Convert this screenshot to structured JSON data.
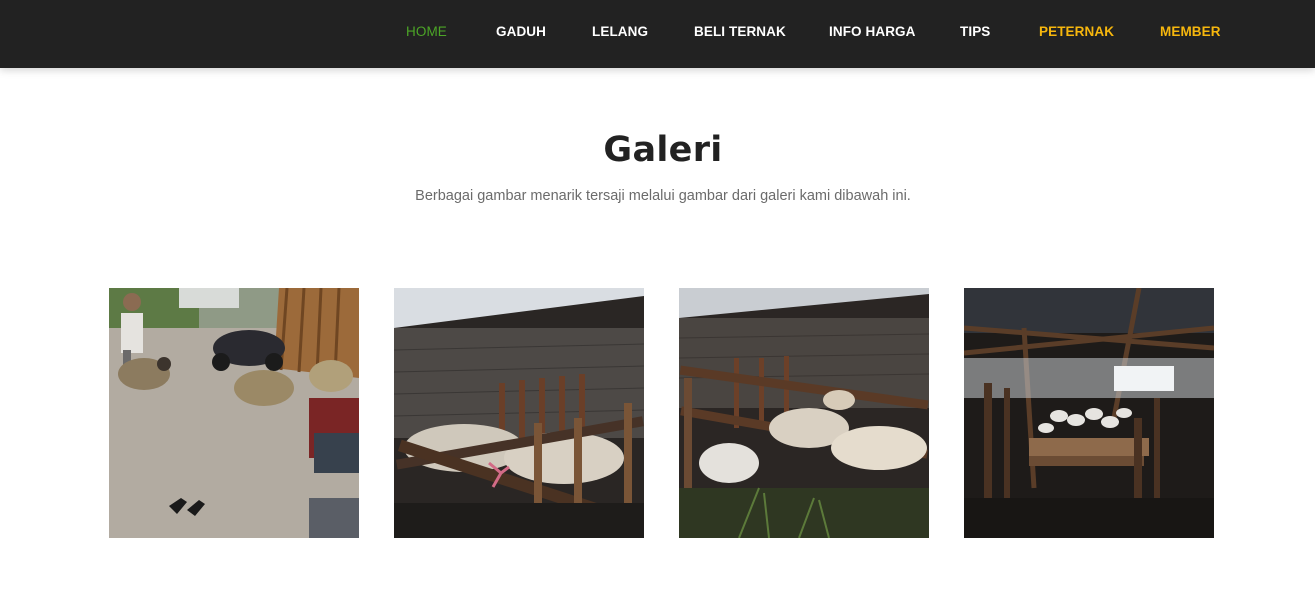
{
  "nav": {
    "items": [
      {
        "label": "HOME",
        "state": "active"
      },
      {
        "label": "GADUH"
      },
      {
        "label": "LELANG"
      },
      {
        "label": "BELI TERNAK"
      },
      {
        "label": "INFO HARGA"
      },
      {
        "label": "TIPS"
      },
      {
        "label": "PETERNAK",
        "style": "accent"
      },
      {
        "label": "MEMBER",
        "style": "accent"
      }
    ]
  },
  "colors": {
    "navbar_bg": "#222222",
    "nav_active": "#4ca527",
    "nav_accent": "#f7b70d",
    "nav_default": "#ffffff",
    "title": "#222222",
    "subtitle": "#6b6b6b"
  },
  "gallery": {
    "title": "Galeri",
    "subtitle": "Berbagai gambar menarik tersaji melalui gambar dari galeri kami dibawah ini.",
    "images": [
      {
        "subject": "sheep-street-photo"
      },
      {
        "subject": "goat-pen-photo"
      },
      {
        "subject": "goat-stall-photo"
      },
      {
        "subject": "barn-interior-photo"
      }
    ]
  }
}
